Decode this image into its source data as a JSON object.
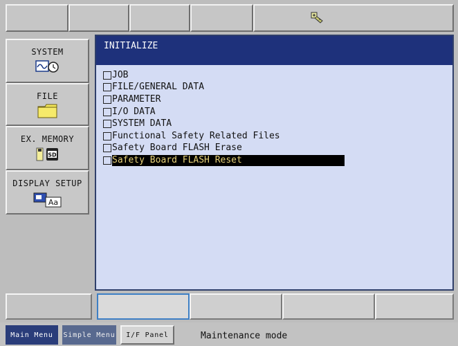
{
  "top_toolbar": {
    "buttons": [
      "",
      "",
      "",
      ""
    ],
    "status_icon": "pendant-status-icon"
  },
  "left_menu": {
    "items": [
      {
        "label": "SYSTEM",
        "icon": "system-clock-wave-icon"
      },
      {
        "label": "FILE",
        "icon": "folder-icon"
      },
      {
        "label": "EX. MEMORY",
        "icon": "sd-card-icon"
      },
      {
        "label": "DISPLAY SETUP",
        "icon": "display-text-icon"
      }
    ]
  },
  "main": {
    "title": "INITIALIZE",
    "items": [
      {
        "label": "JOB",
        "selected": false
      },
      {
        "label": "FILE/GENERAL DATA",
        "selected": false
      },
      {
        "label": "PARAMETER",
        "selected": false
      },
      {
        "label": "I/O DATA",
        "selected": false
      },
      {
        "label": "SYSTEM DATA",
        "selected": false
      },
      {
        "label": "Functional Safety Related Files",
        "selected": false
      },
      {
        "label": "Safety Board FLASH Erase",
        "selected": false
      },
      {
        "label": "Safety Board FLASH Reset",
        "selected": true
      }
    ]
  },
  "function_buttons": [
    "",
    "",
    "",
    "",
    ""
  ],
  "bottom_bar": {
    "tabs": [
      "Main Menu",
      "Simple Menu",
      "I/F Panel"
    ],
    "mode_text": "Maintenance mode"
  },
  "colors": {
    "title_bar": "#1e317b",
    "panel_bg": "#d4dcf4",
    "selection_bg": "#000000",
    "selection_text": "#e9d37a"
  }
}
